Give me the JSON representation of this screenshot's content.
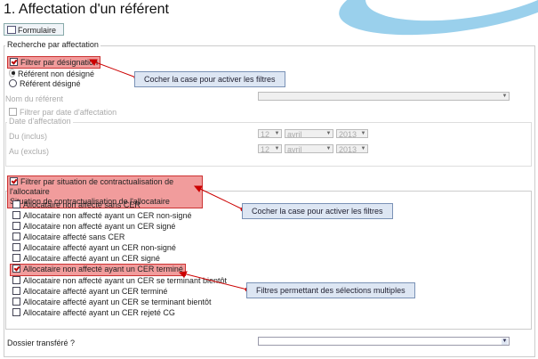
{
  "page": {
    "title": "1. Affectation d'un référent"
  },
  "toolbar": {
    "form_button": "Formulaire"
  },
  "search": {
    "legend": "Recherche par affectation",
    "filter_designation": "Filtrer par désignation",
    "radio_options": [
      "Référent non désigné",
      "Référent désigné"
    ],
    "referent_name_label": "Nom du référent",
    "filter_by_date": "Filtrer par date d'affectation",
    "date_legend": "Date d'affectation",
    "from_label": "Du (inclus)",
    "to_label": "Au (exclus)",
    "day": "12",
    "month": "avril",
    "year": "2013"
  },
  "contract": {
    "filter_label": "Filtrer par situation de contractualisation de l'allocataire",
    "legend": "Situation de contractualisation de l'allocataire",
    "options": [
      "Allocataire non affecté sans CER",
      "Allocataire non affecté ayant un CER non-signé",
      "Allocataire non affecté ayant un CER signé",
      "Allocataire affecté sans CER",
      "Allocataire affecté ayant un CER non-signé",
      "Allocataire affecté ayant un CER signé",
      "Allocataire non affecté ayant un CER terminé",
      "Allocataire non affecté ayant un CER se terminant bientôt",
      "Allocataire affecté ayant un CER terminé",
      "Allocataire affecté ayant un CER se terminant bientôt",
      "Allocataire affecté ayant un CER rejeté CG"
    ]
  },
  "transfer": {
    "label": "Dossier transféré ?"
  },
  "callouts": {
    "c1": "Cocher la case pour activer les filtres",
    "c2": "Cocher la case pour activer les filtres",
    "c3": "Filtres permettant des sélections multiples"
  },
  "colors": {
    "highlight": "#f19c9c",
    "callout_bg": "#dde6f3",
    "arrow": "#cc0000"
  }
}
